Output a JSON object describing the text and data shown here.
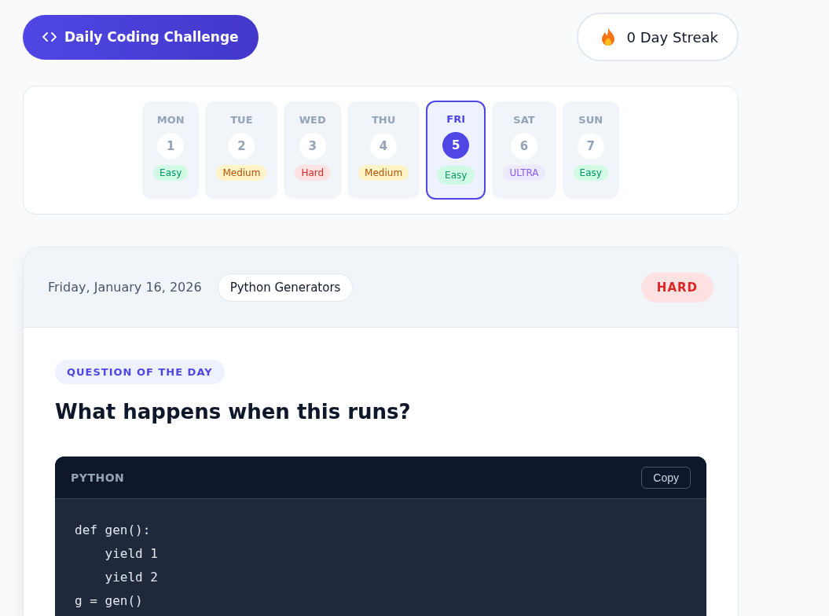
{
  "header": {
    "title": "Daily Coding Challenge",
    "streak": "0 Day Streak"
  },
  "days": [
    {
      "day": "MON",
      "number": "1",
      "difficulty": "Easy",
      "kind": "easy",
      "selected": false
    },
    {
      "day": "TUE",
      "number": "2",
      "difficulty": "Medium",
      "kind": "medium",
      "selected": false
    },
    {
      "day": "WED",
      "number": "3",
      "difficulty": "Hard",
      "kind": "hard",
      "selected": false
    },
    {
      "day": "THU",
      "number": "4",
      "difficulty": "Medium",
      "kind": "medium",
      "selected": false
    },
    {
      "day": "FRI",
      "number": "5",
      "difficulty": "Easy",
      "kind": "easy",
      "selected": true
    },
    {
      "day": "SAT",
      "number": "6",
      "difficulty": "ULTRA",
      "kind": "ultra",
      "selected": false
    },
    {
      "day": "SUN",
      "number": "7",
      "difficulty": "Easy",
      "kind": "easy",
      "selected": false
    }
  ],
  "challenge": {
    "date": "Friday, January 16, 2026",
    "topic": "Python Generators",
    "difficulty": "HARD",
    "kind": "hard",
    "eyebrow": "QUESTION OF THE DAY",
    "question": "What happens when this runs?",
    "code": {
      "language": "PYTHON",
      "copy": "Copy",
      "lines": [
        "def gen():",
        "    yield 1",
        "    yield 2",
        "g = gen()"
      ]
    }
  }
}
